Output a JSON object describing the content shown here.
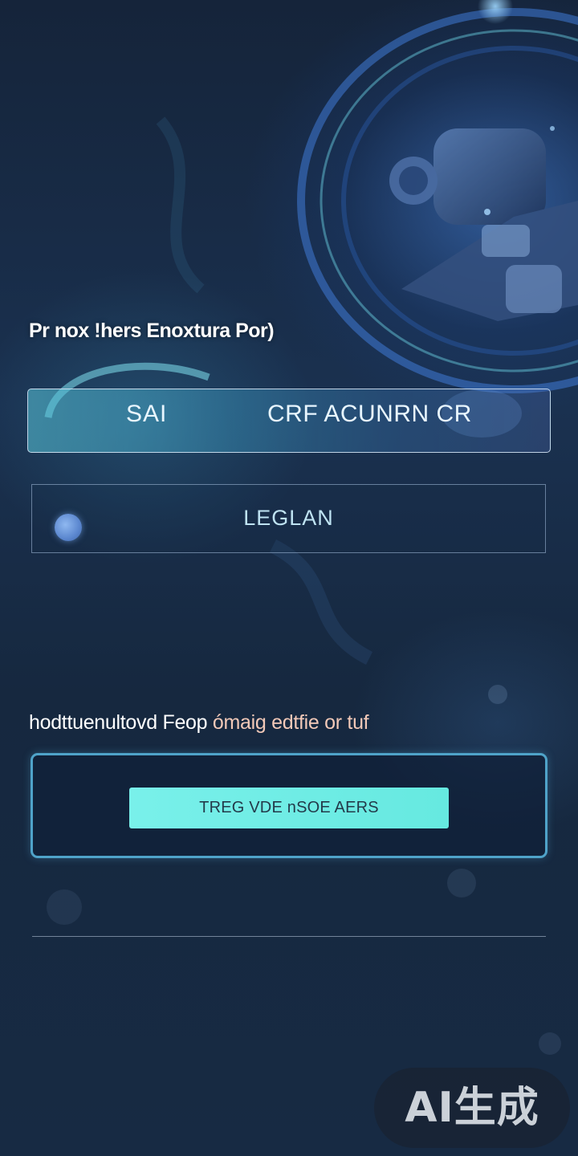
{
  "headline": "Pr nox !hers Enoxtura Por)",
  "primary_card": {
    "left_label": "SAI",
    "right_label": "CRF ACUNRN CR"
  },
  "secondary_card": {
    "label": "LEGLAN",
    "icon": "dot-icon"
  },
  "subhead": {
    "text": "hodttuenultovd Feop",
    "accent": "ómaig edtfie or tuf"
  },
  "cta": {
    "button_label": "TREG  VDE nSOE AERS"
  },
  "watermark": "AI生成",
  "colors": {
    "background": "#16283f",
    "cta_border": "#4fa3c9",
    "cta_button": "#6eece5",
    "accent_text": "#f2c9b8"
  }
}
